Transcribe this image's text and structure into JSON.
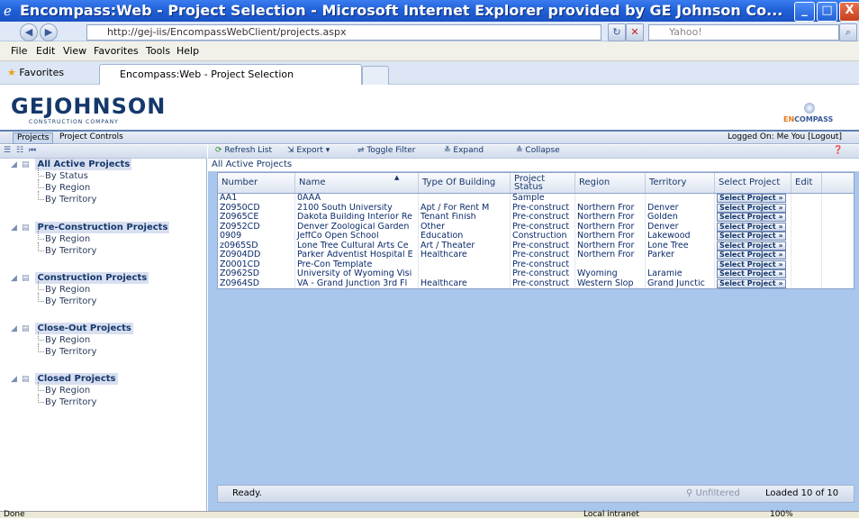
{
  "window": {
    "title": "Encompass:Web - Project Selection - Microsoft Internet Explorer provided by GE Johnson Co...",
    "minimize": "_",
    "maximize": "□",
    "close": "X"
  },
  "address": {
    "url": "http://gej-iis/EncompassWebClient/projects.aspx",
    "search_placeholder": "Yahoo!"
  },
  "menu": [
    "File",
    "Edit",
    "View",
    "Favorites",
    "Tools",
    "Help"
  ],
  "favorites": {
    "label": "Favorites",
    "tab_title": "Encompass:Web - Project Selection"
  },
  "brand": {
    "logo": "GEJOHNSON",
    "sub": "CONSTRUCTION COMPANY",
    "product_en": "EN",
    "product_rest": "COMPASS"
  },
  "apptabs": {
    "projects": "Projects",
    "controls": "Project Controls",
    "logged": "Logged On: Me You  [Logout]"
  },
  "toolbar": {
    "refresh": "Refresh List",
    "export": "Export",
    "toggle": "Toggle Filter",
    "expand": "Expand",
    "collapse": "Collapse"
  },
  "tree": [
    {
      "label": "All Active Projects",
      "children": [
        "By Status",
        "By Region",
        "By Territory"
      ]
    },
    {
      "label": "Pre-Construction Projects",
      "children": [
        "By Region",
        "By Territory"
      ]
    },
    {
      "label": "Construction Projects",
      "children": [
        "By Region",
        "By Territory"
      ]
    },
    {
      "label": "Close-Out Projects",
      "children": [
        "By Region",
        "By Territory"
      ]
    },
    {
      "label": "Closed Projects",
      "children": [
        "By Region",
        "By Territory"
      ]
    }
  ],
  "crumb": "All Active Projects",
  "grid": {
    "columns": [
      "Number",
      "Name",
      "Type Of Building",
      "Project Status",
      "Region",
      "Territory",
      "Select Project",
      "Edit"
    ],
    "select_label": "Select Project",
    "rows": [
      [
        "AA1",
        "0AAA",
        "",
        "Sample",
        "",
        ""
      ],
      [
        "Z0950CD",
        "2100 South University",
        "Apt / For Rent M",
        "Pre-construct",
        "Northern Fror",
        "Denver"
      ],
      [
        "Z0965CE",
        "Dakota Building Interior Re",
        "Tenant Finish",
        "Pre-construct",
        "Northern Fror",
        "Golden"
      ],
      [
        "Z0952CD",
        "Denver Zoological Garden",
        "Other",
        "Pre-construct",
        "Northern Fror",
        "Denver"
      ],
      [
        "0909",
        "JeffCo Open School",
        "Education",
        "Construction",
        "Northern Fror",
        "Lakewood"
      ],
      [
        "z0965SD",
        "Lone Tree Cultural Arts Ce",
        "Art / Theater",
        "Pre-construct",
        "Northern Fror",
        "Lone Tree"
      ],
      [
        "Z0904DD",
        "Parker Adventist Hospital E",
        "Healthcare",
        "Pre-construct",
        "Northern Fror",
        "Parker"
      ],
      [
        "Z0001CD",
        "Pre-Con Template",
        "",
        "Pre-construct",
        "",
        ""
      ],
      [
        "Z0962SD",
        "University of Wyoming Visi",
        "",
        "Pre-construct",
        "Wyoming",
        "Laramie"
      ],
      [
        "Z0964SD",
        "VA - Grand Junction 3rd Fl",
        "Healthcare",
        "Pre-construct",
        "Western Slop",
        "Grand Junctic"
      ]
    ]
  },
  "gridstatus": {
    "ready": "Ready.",
    "filter": "Unfiltered",
    "loaded": "Loaded 10 of 10"
  },
  "winstatus": {
    "done": "Done",
    "zone": "Local intranet",
    "zoom": "100%"
  }
}
